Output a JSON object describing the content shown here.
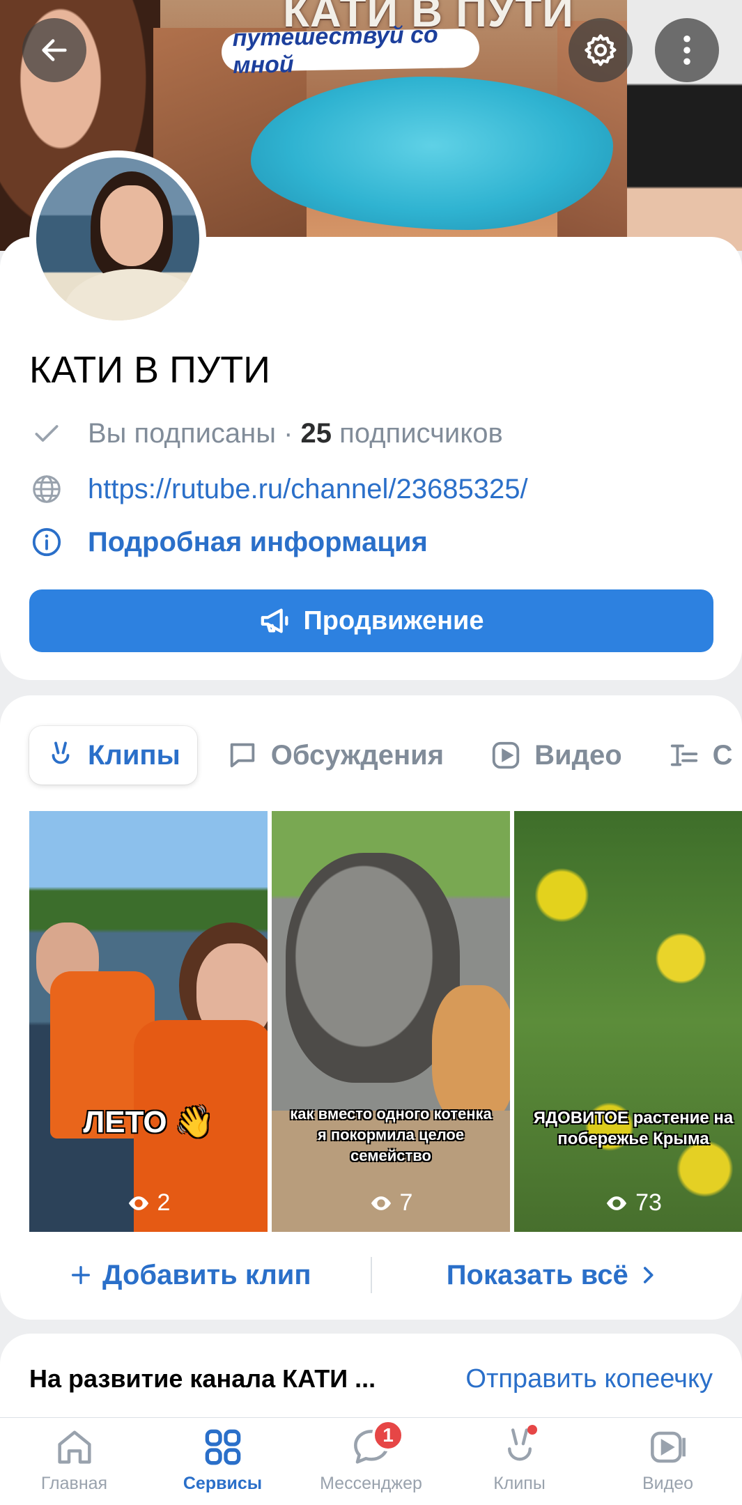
{
  "cover": {
    "title": "КАТИ В ПУТИ",
    "subtitle": "путешествуй со мной"
  },
  "header_buttons": {
    "back_icon": "arrow-left-icon",
    "settings_icon": "gear-icon",
    "more_icon": "more-vertical-icon"
  },
  "profile": {
    "name": "КАТИ В ПУТИ",
    "subscribed_text": "Вы подписаны · ",
    "subscribers_count": "25",
    "subscribers_label": " подписчиков",
    "link": "https://rutube.ru/channel/23685325/",
    "details_label": "Подробная информация",
    "promote_label": "Продвижение"
  },
  "tabs": [
    {
      "label": "Клипы",
      "icon": "clips-icon",
      "active": true
    },
    {
      "label": "Обсуждения",
      "icon": "discussion-icon",
      "active": false
    },
    {
      "label": "Видео",
      "icon": "video-icon",
      "active": false
    },
    {
      "label": "С",
      "icon": "list-icon",
      "active": false
    }
  ],
  "clips": [
    {
      "caption": "ЛЕТО 👋",
      "views": "2"
    },
    {
      "caption": "как вместо одного котенка я покормила целое семейство",
      "views": "7"
    },
    {
      "caption": "ЯДОВИТОЕ растение на побережье Крыма",
      "views": "73"
    }
  ],
  "clip_actions": {
    "add_label": "Добавить клип",
    "show_all_label": "Показать всё"
  },
  "donation": {
    "title": "На развитие канала КАТИ ...",
    "action_label": "Отправить копеечку"
  },
  "bottom_nav": [
    {
      "label": "Главная",
      "icon": "home-icon",
      "active": false
    },
    {
      "label": "Сервисы",
      "icon": "services-icon",
      "active": true
    },
    {
      "label": "Мессенджер",
      "icon": "messenger-icon",
      "active": false,
      "badge": "1"
    },
    {
      "label": "Клипы",
      "icon": "clips-icon",
      "active": false,
      "dot": true
    },
    {
      "label": "Видео",
      "icon": "video-icon",
      "active": false
    }
  ],
  "colors": {
    "accent": "#2d81e0",
    "link": "#2a6fc9",
    "badge": "#e64646",
    "secondary_text": "#818c99"
  }
}
